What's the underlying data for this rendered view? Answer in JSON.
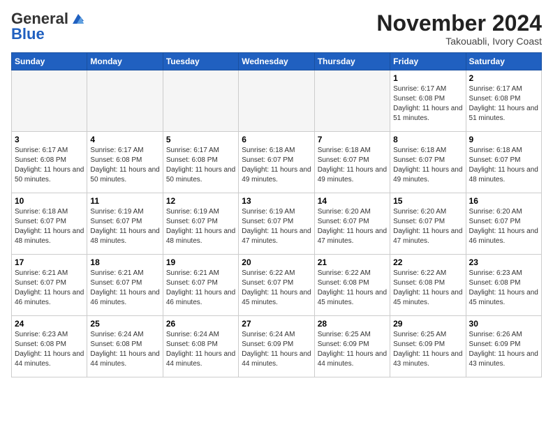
{
  "header": {
    "logo_general": "General",
    "logo_blue": "Blue",
    "month_title": "November 2024",
    "location": "Takouabli, Ivory Coast"
  },
  "days_of_week": [
    "Sunday",
    "Monday",
    "Tuesday",
    "Wednesday",
    "Thursday",
    "Friday",
    "Saturday"
  ],
  "weeks": [
    [
      {
        "day": "",
        "info": ""
      },
      {
        "day": "",
        "info": ""
      },
      {
        "day": "",
        "info": ""
      },
      {
        "day": "",
        "info": ""
      },
      {
        "day": "",
        "info": ""
      },
      {
        "day": "1",
        "info": "Sunrise: 6:17 AM\nSunset: 6:08 PM\nDaylight: 11 hours and 51 minutes."
      },
      {
        "day": "2",
        "info": "Sunrise: 6:17 AM\nSunset: 6:08 PM\nDaylight: 11 hours and 51 minutes."
      }
    ],
    [
      {
        "day": "3",
        "info": "Sunrise: 6:17 AM\nSunset: 6:08 PM\nDaylight: 11 hours and 50 minutes."
      },
      {
        "day": "4",
        "info": "Sunrise: 6:17 AM\nSunset: 6:08 PM\nDaylight: 11 hours and 50 minutes."
      },
      {
        "day": "5",
        "info": "Sunrise: 6:17 AM\nSunset: 6:08 PM\nDaylight: 11 hours and 50 minutes."
      },
      {
        "day": "6",
        "info": "Sunrise: 6:18 AM\nSunset: 6:07 PM\nDaylight: 11 hours and 49 minutes."
      },
      {
        "day": "7",
        "info": "Sunrise: 6:18 AM\nSunset: 6:07 PM\nDaylight: 11 hours and 49 minutes."
      },
      {
        "day": "8",
        "info": "Sunrise: 6:18 AM\nSunset: 6:07 PM\nDaylight: 11 hours and 49 minutes."
      },
      {
        "day": "9",
        "info": "Sunrise: 6:18 AM\nSunset: 6:07 PM\nDaylight: 11 hours and 48 minutes."
      }
    ],
    [
      {
        "day": "10",
        "info": "Sunrise: 6:18 AM\nSunset: 6:07 PM\nDaylight: 11 hours and 48 minutes."
      },
      {
        "day": "11",
        "info": "Sunrise: 6:19 AM\nSunset: 6:07 PM\nDaylight: 11 hours and 48 minutes."
      },
      {
        "day": "12",
        "info": "Sunrise: 6:19 AM\nSunset: 6:07 PM\nDaylight: 11 hours and 48 minutes."
      },
      {
        "day": "13",
        "info": "Sunrise: 6:19 AM\nSunset: 6:07 PM\nDaylight: 11 hours and 47 minutes."
      },
      {
        "day": "14",
        "info": "Sunrise: 6:20 AM\nSunset: 6:07 PM\nDaylight: 11 hours and 47 minutes."
      },
      {
        "day": "15",
        "info": "Sunrise: 6:20 AM\nSunset: 6:07 PM\nDaylight: 11 hours and 47 minutes."
      },
      {
        "day": "16",
        "info": "Sunrise: 6:20 AM\nSunset: 6:07 PM\nDaylight: 11 hours and 46 minutes."
      }
    ],
    [
      {
        "day": "17",
        "info": "Sunrise: 6:21 AM\nSunset: 6:07 PM\nDaylight: 11 hours and 46 minutes."
      },
      {
        "day": "18",
        "info": "Sunrise: 6:21 AM\nSunset: 6:07 PM\nDaylight: 11 hours and 46 minutes."
      },
      {
        "day": "19",
        "info": "Sunrise: 6:21 AM\nSunset: 6:07 PM\nDaylight: 11 hours and 46 minutes."
      },
      {
        "day": "20",
        "info": "Sunrise: 6:22 AM\nSunset: 6:07 PM\nDaylight: 11 hours and 45 minutes."
      },
      {
        "day": "21",
        "info": "Sunrise: 6:22 AM\nSunset: 6:08 PM\nDaylight: 11 hours and 45 minutes."
      },
      {
        "day": "22",
        "info": "Sunrise: 6:22 AM\nSunset: 6:08 PM\nDaylight: 11 hours and 45 minutes."
      },
      {
        "day": "23",
        "info": "Sunrise: 6:23 AM\nSunset: 6:08 PM\nDaylight: 11 hours and 45 minutes."
      }
    ],
    [
      {
        "day": "24",
        "info": "Sunrise: 6:23 AM\nSunset: 6:08 PM\nDaylight: 11 hours and 44 minutes."
      },
      {
        "day": "25",
        "info": "Sunrise: 6:24 AM\nSunset: 6:08 PM\nDaylight: 11 hours and 44 minutes."
      },
      {
        "day": "26",
        "info": "Sunrise: 6:24 AM\nSunset: 6:08 PM\nDaylight: 11 hours and 44 minutes."
      },
      {
        "day": "27",
        "info": "Sunrise: 6:24 AM\nSunset: 6:09 PM\nDaylight: 11 hours and 44 minutes."
      },
      {
        "day": "28",
        "info": "Sunrise: 6:25 AM\nSunset: 6:09 PM\nDaylight: 11 hours and 44 minutes."
      },
      {
        "day": "29",
        "info": "Sunrise: 6:25 AM\nSunset: 6:09 PM\nDaylight: 11 hours and 43 minutes."
      },
      {
        "day": "30",
        "info": "Sunrise: 6:26 AM\nSunset: 6:09 PM\nDaylight: 11 hours and 43 minutes."
      }
    ]
  ]
}
